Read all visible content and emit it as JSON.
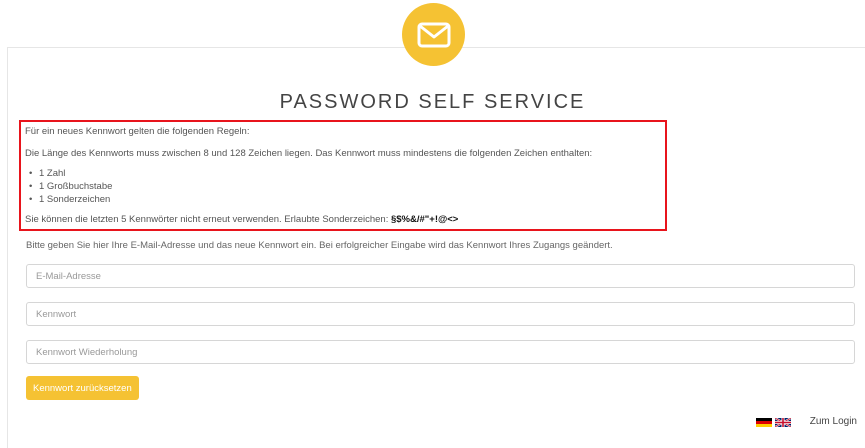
{
  "header": {
    "icon": "mail-icon",
    "title": "PASSWORD SELF SERVICE",
    "accent_color": "#f5c233"
  },
  "rules": {
    "intro": "Für ein neues Kennwort gelten die folgenden Regeln:",
    "length_text": "Die Länge des Kennworts muss zwischen 8 und 128 Zeichen liegen. Das Kennwort muss mindestens die folgenden Zeichen enthalten:",
    "items": [
      "1 Zahl",
      "1 Großbuchstabe",
      "1 Sonderzeichen"
    ],
    "history_text": "Sie können die letzten 5 Kennwörter nicht erneut verwenden. Erlaubte Sonderzeichen: ",
    "special_chars": "§$%&/#\"+!@<>",
    "highlight_color": "#e8141c"
  },
  "form": {
    "intro": "Bitte geben Sie hier Ihre E-Mail-Adresse und das neue Kennwort ein. Bei erfolgreicher Eingabe wird das Kennwort Ihres Zugangs geändert.",
    "email_placeholder": "E-Mail-Adresse",
    "password_placeholder": "Kennwort",
    "password_repeat_placeholder": "Kennwort Wiederholung",
    "submit_label": "Kennwort zurücksetzen"
  },
  "footer": {
    "flags": [
      "german-flag-icon",
      "uk-flag-icon"
    ],
    "login_link": "Zum Login"
  }
}
